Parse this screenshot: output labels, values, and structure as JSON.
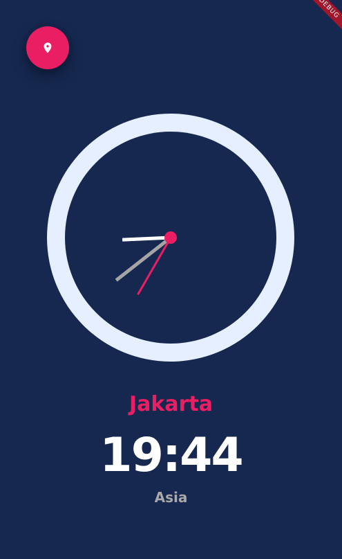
{
  "debug_banner": {
    "label": "DEBUG"
  },
  "location_button": {
    "icon": "location-pin-icon"
  },
  "clock": {
    "hour": 19,
    "minute": 44,
    "second": 35,
    "colors": {
      "ring": "#e6efff",
      "face": "#16284f",
      "hour_hand": "#a5a5a5",
      "minute_hand": "#ffffff",
      "second_hand": "#e91e63",
      "center_dot": "#e91e63"
    }
  },
  "city": "Jakarta",
  "time": "19:44",
  "region": "Asia",
  "colors": {
    "background": "#16284f",
    "accent": "#e91e63",
    "text_primary": "#ffffff",
    "text_secondary": "#a9a9a9"
  }
}
